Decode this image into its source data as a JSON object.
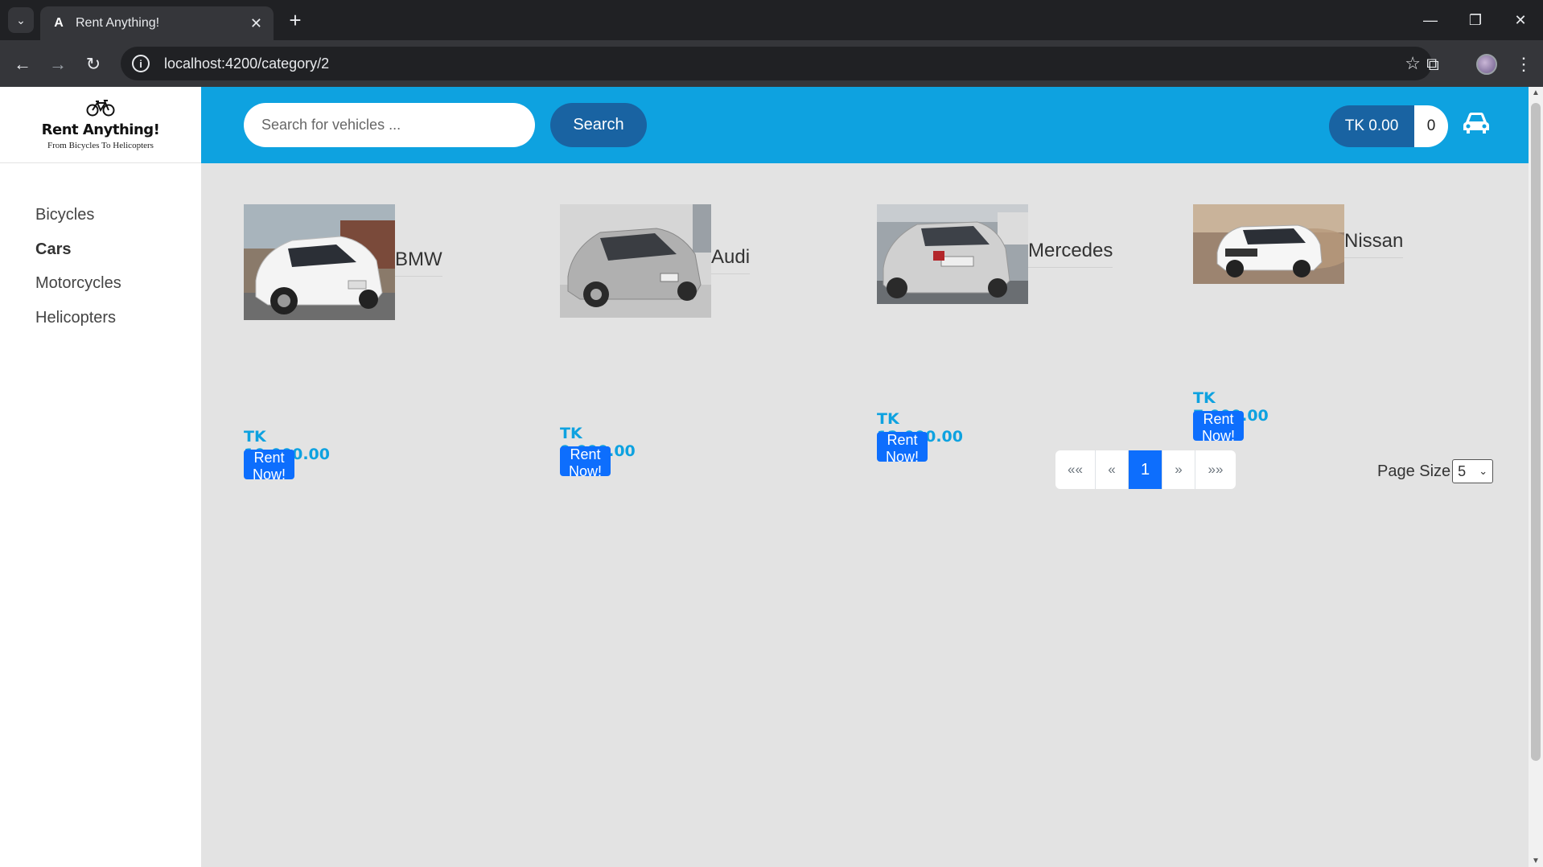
{
  "browser": {
    "tab_title": "Rent Anything!",
    "tab_favicon": "A",
    "url": "localhost:4200/category/2"
  },
  "brand": {
    "name": "Rent Anything!",
    "tagline": "From Bicycles To Helicopters"
  },
  "sidebar": {
    "items": [
      {
        "label": "Bicycles"
      },
      {
        "label": "Cars"
      },
      {
        "label": "Motorcycles"
      },
      {
        "label": "Helicopters"
      }
    ]
  },
  "header": {
    "search_placeholder": "Search for vehicles ...",
    "search_label": "Search",
    "cart_total": "TK 0.00",
    "cart_qty": "0"
  },
  "products": [
    {
      "name": "BMW",
      "price": "TK 10,000.00",
      "action": "Rent Now!",
      "image_color": "#f2f2f2"
    },
    {
      "name": "Audi",
      "price": "TK 9,000.00",
      "action": "Rent Now!",
      "image_color": "#b8b8b8"
    },
    {
      "name": "Mercedes",
      "price": "TK 12,000.00",
      "action": "Rent Now!",
      "image_color": "#c8c8c8"
    },
    {
      "name": "Nissan",
      "price": "TK 7,000.00",
      "action": "Rent Now!",
      "image_color": "#ffffff"
    }
  ],
  "pagination": {
    "first": "««",
    "prev": "«",
    "current": "1",
    "next": "»",
    "last": "»»",
    "page_size_label": "Page Size",
    "page_size_value": "5"
  },
  "colors": {
    "header_bg": "#0ea2e0",
    "button_dark": "#1963a2",
    "primary": "#0d6efd",
    "price": "#0ea2e0"
  }
}
